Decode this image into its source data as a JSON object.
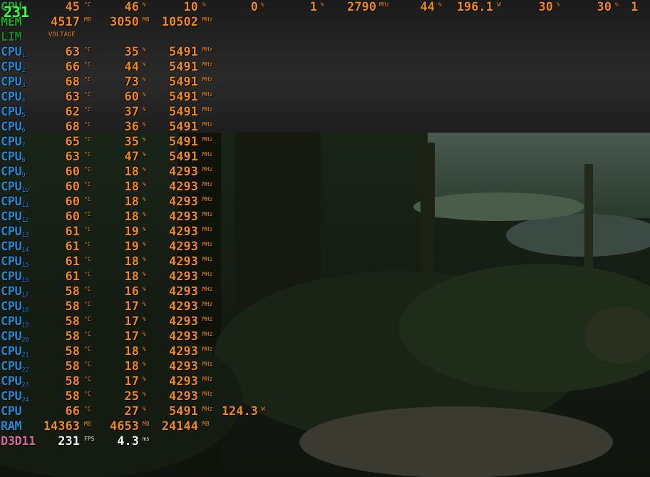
{
  "fps_counter": "231",
  "gpu_row": {
    "label": "GPU",
    "values": [
      {
        "v": "45",
        "u": "°C"
      },
      {
        "v": "46",
        "u": "%"
      },
      {
        "v": "10",
        "u": "%"
      },
      {
        "v": "0",
        "u": "%"
      },
      {
        "v": "1",
        "u": "%"
      },
      {
        "v": "2790",
        "u": "MHz"
      },
      {
        "v": "44",
        "u": "%"
      },
      {
        "v": "196.1",
        "u": "W"
      },
      {
        "v": "30",
        "u": "%"
      },
      {
        "v": "30",
        "u": "%"
      },
      {
        "v": "1",
        "u": ""
      }
    ]
  },
  "mem_row": {
    "label": "MEM",
    "values": [
      {
        "v": "4517",
        "u": "MB"
      },
      {
        "v": "3050",
        "u": "MB"
      },
      {
        "v": "10502",
        "u": "MHz"
      }
    ],
    "sublabel": "VOLTAGE"
  },
  "lim_row": {
    "label": "LIM"
  },
  "cores": [
    {
      "name": "CPU",
      "idx": "1",
      "temp": "63",
      "load": "35",
      "clock": "5491"
    },
    {
      "name": "CPU",
      "idx": "2",
      "temp": "66",
      "load": "44",
      "clock": "5491"
    },
    {
      "name": "CPU",
      "idx": "3",
      "temp": "68",
      "load": "73",
      "clock": "5491"
    },
    {
      "name": "CPU",
      "idx": "4",
      "temp": "63",
      "load": "60",
      "clock": "5491"
    },
    {
      "name": "CPU",
      "idx": "5",
      "temp": "62",
      "load": "37",
      "clock": "5491"
    },
    {
      "name": "CPU",
      "idx": "6",
      "temp": "68",
      "load": "36",
      "clock": "5491"
    },
    {
      "name": "CPU",
      "idx": "7",
      "temp": "65",
      "load": "35",
      "clock": "5491"
    },
    {
      "name": "CPU",
      "idx": "8",
      "temp": "63",
      "load": "47",
      "clock": "5491"
    },
    {
      "name": "CPU",
      "idx": "9",
      "temp": "60",
      "load": "18",
      "clock": "4293"
    },
    {
      "name": "CPU",
      "idx": "10",
      "temp": "60",
      "load": "18",
      "clock": "4293"
    },
    {
      "name": "CPU",
      "idx": "11",
      "temp": "60",
      "load": "18",
      "clock": "4293"
    },
    {
      "name": "CPU",
      "idx": "12",
      "temp": "60",
      "load": "18",
      "clock": "4293"
    },
    {
      "name": "CPU",
      "idx": "13",
      "temp": "61",
      "load": "19",
      "clock": "4293"
    },
    {
      "name": "CPU",
      "idx": "14",
      "temp": "61",
      "load": "19",
      "clock": "4293"
    },
    {
      "name": "CPU",
      "idx": "15",
      "temp": "61",
      "load": "18",
      "clock": "4293"
    },
    {
      "name": "CPU",
      "idx": "16",
      "temp": "61",
      "load": "18",
      "clock": "4293"
    },
    {
      "name": "CPU",
      "idx": "17",
      "temp": "58",
      "load": "16",
      "clock": "4293"
    },
    {
      "name": "CPU",
      "idx": "18",
      "temp": "58",
      "load": "17",
      "clock": "4293"
    },
    {
      "name": "CPU",
      "idx": "19",
      "temp": "58",
      "load": "17",
      "clock": "4293"
    },
    {
      "name": "CPU",
      "idx": "20",
      "temp": "58",
      "load": "17",
      "clock": "4293"
    },
    {
      "name": "CPU",
      "idx": "21",
      "temp": "58",
      "load": "18",
      "clock": "4293"
    },
    {
      "name": "CPU",
      "idx": "22",
      "temp": "58",
      "load": "18",
      "clock": "4293"
    },
    {
      "name": "CPU",
      "idx": "23",
      "temp": "58",
      "load": "17",
      "clock": "4293"
    },
    {
      "name": "CPU",
      "idx": "24",
      "temp": "58",
      "load": "25",
      "clock": "4293"
    }
  ],
  "units": {
    "temp": "°C",
    "load": "%",
    "clock": "MHz"
  },
  "cpu_total": {
    "label": "CPU",
    "temp": "66",
    "load": "27",
    "clock": "5491",
    "power": "124.3",
    "power_unit": "W"
  },
  "ram_row": {
    "label": "RAM",
    "values": [
      {
        "v": "14363",
        "u": "MB"
      },
      {
        "v": "4653",
        "u": "MB"
      },
      {
        "v": "24144",
        "u": "MB"
      }
    ]
  },
  "d3d_row": {
    "label": "D3D11",
    "fps": "231",
    "fps_unit": "FPS",
    "frametime": "4.3",
    "frametime_unit": "ms"
  },
  "colors": {
    "value_orange": "#f08a1c",
    "cpu_blue": "#1e8fd6",
    "mem_green": "#1ea82a",
    "fps_green": "#3cff3c",
    "d3d_pink": "#d86aa0"
  }
}
